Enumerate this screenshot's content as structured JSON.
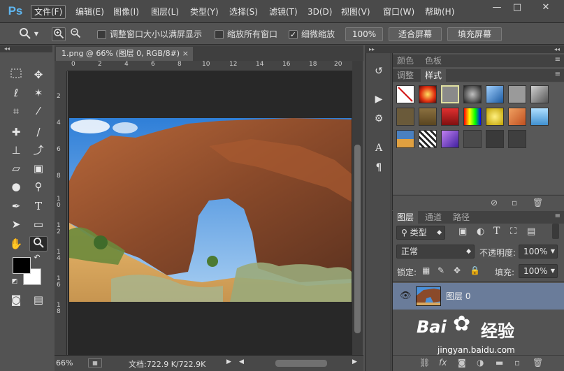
{
  "app": {
    "logo": "Ps"
  },
  "menu": [
    "文件(F)",
    "编辑(E)",
    "图像(I)",
    "图层(L)",
    "类型(Y)",
    "选择(S)",
    "滤镜(T)",
    "3D(D)",
    "视图(V)",
    "窗口(W)",
    "帮助(H)"
  ],
  "window_controls": {
    "minimize": "—",
    "restore": "□",
    "close": "✕"
  },
  "options": {
    "resize_windows_label": "调整窗口大小以满屏显示",
    "resize_windows_checked": false,
    "zoom_all_label": "缩放所有窗口",
    "zoom_all_checked": false,
    "scrubby_zoom_label": "细微缩放",
    "scrubby_zoom_checked": true,
    "actual_pixels": "100%",
    "fit_screen": "适合屏幕",
    "fill_screen": "填充屏幕"
  },
  "document": {
    "tab_title": "1.png @ 66% (图层 0, RGB/8#)",
    "close": "×",
    "ruler_h": [
      "0",
      "2",
      "4",
      "6",
      "8",
      "10",
      "12",
      "14",
      "16",
      "18",
      "20"
    ],
    "ruler_v": [
      "2",
      "4",
      "6",
      "8",
      "1 0",
      "1 2",
      "1 4",
      "1 6",
      "1 8"
    ],
    "zoom": "66%",
    "doc_size": "文档:722.9 K/722.9K"
  },
  "panels": {
    "color_tabs": [
      "颜色",
      "色板"
    ],
    "style_tabs": [
      "调整",
      "样式"
    ],
    "layer_tabs": [
      "图层",
      "通道",
      "路径"
    ],
    "filter_kind": "类型",
    "blend_mode": "正常",
    "opacity_label": "不透明度:",
    "opacity_value": "100%",
    "lock_label": "锁定:",
    "fill_label": "填充:",
    "fill_value": "100%",
    "layer_name": "图层 0"
  },
  "watermark": {
    "brand": "Bai",
    "brand2": "经验",
    "url": "jingyan.baidu.com"
  }
}
